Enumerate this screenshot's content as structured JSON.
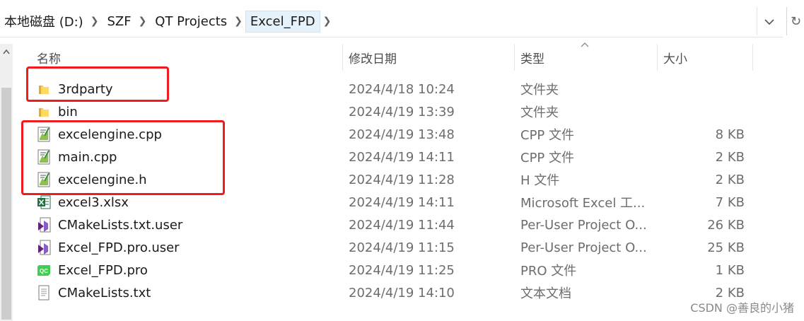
{
  "breadcrumb": [
    "本地磁盘 (D:)",
    "SZF",
    "QT Projects",
    "Excel_FPD"
  ],
  "columns": {
    "name": "名称",
    "date": "修改日期",
    "type": "类型",
    "size": "大小"
  },
  "files": [
    {
      "icon": "folder-icon",
      "name": "3rdparty",
      "date": "2024/4/18 10:24",
      "type": "文件夹",
      "size": ""
    },
    {
      "icon": "folder-icon",
      "name": "bin",
      "date": "2024/4/19 13:39",
      "type": "文件夹",
      "size": ""
    },
    {
      "icon": "cpp-file-icon",
      "name": "excelengine.cpp",
      "date": "2024/4/19 13:48",
      "type": "CPP 文件",
      "size": "8 KB"
    },
    {
      "icon": "cpp-file-icon",
      "name": "main.cpp",
      "date": "2024/4/19 14:11",
      "type": "CPP 文件",
      "size": "2 KB"
    },
    {
      "icon": "header-file-icon",
      "name": "excelengine.h",
      "date": "2024/4/19 11:28",
      "type": "H 文件",
      "size": "2 KB"
    },
    {
      "icon": "excel-file-icon",
      "name": "excel3.xlsx",
      "date": "2024/4/19 14:11",
      "type": "Microsoft Excel 工...",
      "size": "7 KB"
    },
    {
      "icon": "visual-studio-icon",
      "name": "CMakeLists.txt.user",
      "date": "2024/4/19 11:44",
      "type": "Per-User Project O...",
      "size": "26 KB"
    },
    {
      "icon": "visual-studio-icon",
      "name": "Excel_FPD.pro.user",
      "date": "2024/4/19 11:15",
      "type": "Per-User Project O...",
      "size": "25 KB"
    },
    {
      "icon": "qt-project-icon",
      "name": "Excel_FPD.pro",
      "date": "2024/4/19 11:25",
      "type": "PRO 文件",
      "size": "1 KB"
    },
    {
      "icon": "text-file-icon",
      "name": "CMakeLists.txt",
      "date": "2024/4/19 14:10",
      "type": "文本文档",
      "size": "2 KB"
    }
  ],
  "highlight_color": "#ee1c1c",
  "watermark": "CSDN @善良的小猪"
}
